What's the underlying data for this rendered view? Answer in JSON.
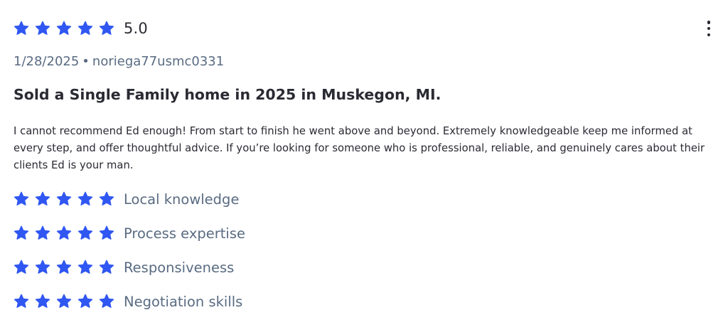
{
  "review": {
    "overall_rating": 5,
    "overall_score_text": "5.0",
    "date": "1/28/2025",
    "separator": "•",
    "username": "noriega77usmc0331",
    "title": "Sold a Single Family home in 2025 in Muskegon, MI.",
    "body": "I cannot recommend Ed enough! From start to finish he went above and beyond. Extremely knowledgeable keep me informed at every step, and offer thoughtful advice. If you’re looking for someone who is professional, reliable, and genuinely cares about their clients Ed is your man.",
    "menu_icon": "more-vertical-icon",
    "categories": [
      {
        "label": "Local knowledge",
        "rating": 5
      },
      {
        "label": "Process expertise",
        "rating": 5
      },
      {
        "label": "Responsiveness",
        "rating": 5
      },
      {
        "label": "Negotiation skills",
        "rating": 5
      }
    ]
  },
  "colors": {
    "star": "#3057f2",
    "text_primary": "#2a2a33",
    "text_secondary": "#596b82"
  },
  "icons": {
    "star": "star-icon"
  }
}
